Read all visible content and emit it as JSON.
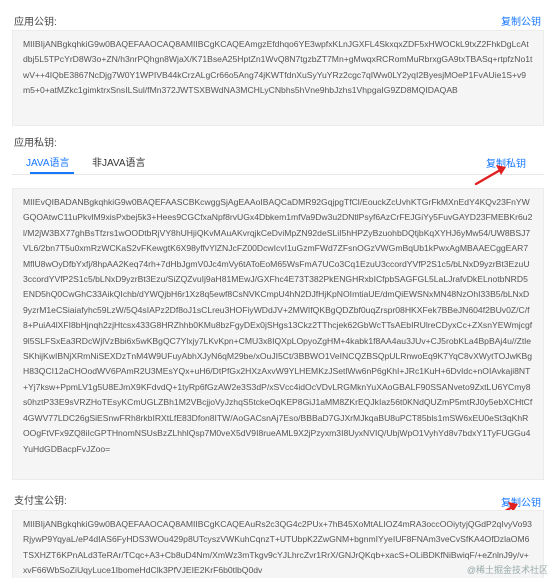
{
  "app_public_key": {
    "label": "应用公钥:",
    "copy_label": "复制公钥",
    "value": "MIIBIjANBgkqhkiG9w0BAQEFAAOCAQ8AMIIBCgKCAQEAmgzEfdhqo6YE3wpfxKLnJGXFL4SkxqxZDF5xHWOCkL9txZ2FhkDgLcAtdbj5L5TPcYrD8W3o+ZN/h3nrPQhgn8WjaX/K71BseA25HptZn1WvQ8N7tgzbZT7Mn+gMwqxRCRomMuRbrxgGA9txTBASq+rtpfzNo1twV++4IQbE3867NcDjg7W0Y1WPIVB44kCrzALgCr66o5Ang74jKWTfdnXuSyYuYRz2cgc7qIWw0LY2yqI2ByesjMOeP1FvAUie1S+v9m5+0+atMZkc1gimktrxSnsILSul/fMn372JWTSXBWdNA3MCHLyCNbhs5hVne9hbJzhs1VhpgaIG9ZD8MQIDAQAB"
  },
  "app_private_key": {
    "label": "应用私钥:",
    "copy_label": "复制私钥",
    "tabs": [
      "JAVA语言",
      "非JAVA语言"
    ],
    "value": "MIIEvQIBADANBgkqhkiG9w0BAQEFAASCBKcwggSjAgEAAoIBAQCaDMR92GqjpgTfCl/EouckZcUvhKTGrFkMXnEdY4KQv23FnYWGQOAtwC11uPkvlM9xisPxbej5k3+Hees9CGCfxaNpf8rvUGx4Dbkem1mfVa9Dw3u2DNtlPsyf6AzCrFEJGiYy5FuvGAYD23FMEBKr6u2l/M2jW3BX77ghBsTfzrs1wOODtbRjVY8hUHjiQKvMAuAKvrqjkCeDviMpZN92deSLiI5hHPZyBzuohbDQtjbKqXYHJ6yMw54/UW8BSJ7VL6/2bn7T5u0xmRzWCKaS2vFKewgtK6X98yffvYlZNJcFZ00DcwIcvI1uGzmFWd7ZFsnOGzVWGmBqUb1kPwxAgMBAAECggEAR7MflU8wOyDfbYxfj/8hpAA2Keq74rh+7dHbJgmV0Jc4mVy6tAToEoM65WsFmA7UCo3Cq1EzuU3ccordYVfP2S1c5/bLNxD9yzrBt3EzuU3ccordYVfP2S1c5/bLNxD9yzrBt3Ezu/SiZQZvuIj9aH81MEwJ/GXFhc4E73T382PkENGHRxbICfpbSAGFGL5LaLJrafvDkELnotbNRD5END5hQ0CwGhC33AikQIchb/dYWQjbH6r1Xz8q5ewf8CsNVKCmpU4hN2DJfHjKpNOImtiaUE/dmQiEWSNxMN48NzOhI33B5/bLNxD9yzrM1eCSiaiafyhc59LzW/5Q4sIAPz2Df8oJ1sCLreu3HOFiyWDdJV+2MWIfQKBgQDZbf0uqZrspr08HKXFek7BBeJN604f2BUv0Z/C/f8+PuiA4lXFI8bHjnqh2zjHtcsx433G8HRZhhb0KMu8bzFgyDEx0jSHgs13Ckz2TThcjek62GbWcTTsAEbIRUlreCDyxCc+ZXsnYEWmjcgf9l5SLFSxEa3RDcWjlVzBbi6x5wKBgQC7Ylxjy7LKvKpn+CMU3x8IQXpLOpyoZgHM+4kabk1f8AA4au3JUv+CJ5robKLa4BpBAj4u//ZtleSKhijKwIBNjXRmNiSEXDzTnM4W9UFuyAbhXJyN6qM29be/xOuJI5Ct/3BBWO1VeINCQZBSQpULRnwoEq9K7YqC8vXWytTOJwKBgH83QCI12aCHOodWV6PAmR2U3MEsYQx+uH6/DtPfGx2HXzAxvW9YLHEMKzJSetlWw6nP6gKhI+JRc1KuH+6DvIdc+nOIAvkaji8NT+Yj7ksw+PpmLV1g5U8EJmX9KFdvdQ+1tyRp6fGzAW2e3S3dP/xSVcc4idOcVDvLRGMknYuXAoGBALF90SSANveto9ZxtLU6YCmy8s0hztP33E9sVRZHoTEsyKCmUGLZBh1M2VBcjjoVyJzhqS5tckeOqKEP8GiJ1aMM8ZKrEQJkIaz56t0KNdQUZmP5mtRJ0y5ebXCHtCf4GWV77LDC26gSiESnwFRh8rkbIRXtLfE83Dfon8ITW/AoGACsnAj7Eso/BBBaD7GJXrMJkqaBU8uPCT85bls1mSW6xEU0eSt3qKhROOgFtVFx9ZQ8iIcGPTHnomNSUsBzZLhhlQsp7M0veX5dV9I8rueAML9X2jPzyxm3I8UyxNVIQ/UbjWpO1VyhYd8v7bdxY1TyFUGGu4YuHdGDBacpFvJZoo="
  },
  "alipay_public_key": {
    "label": "支付宝公钥:",
    "copy_label": "复制公钥",
    "value": "MIIBIjANBgkqhkiG9w0BAQEFAAOCAQ8AMIIBCgKCAQEAuRs2c3QG4c2PUx+7hB45XoMtALIOZ4mRA3occOOiytyjQGdP2qIvyVo93RjywP9YqyaL/eP4dIAS6FyHDS3WOu429p8UTcyszVWKuhCqnzT+UTUbpK2ZwGNM+bgnmIYyeIUF8FNAm3veCvSfKA4OfDzlaOM6TSXHZT6KPnALd3TeRAr/TCqc+A3+Cb8uD4Nm/XmWz3mTkgv9cYJLhrcZvr1RrX/GNJrQKqb+xacS+OLiBDKfNiBwiqF/+eZnlnJ9y/v+xvF66WbSoZiUqyLuce1IbomeHdClk3PfVJEIE2KrF6b0tlbQ0dv"
  },
  "watermark": "@稀土掘金技术社区"
}
